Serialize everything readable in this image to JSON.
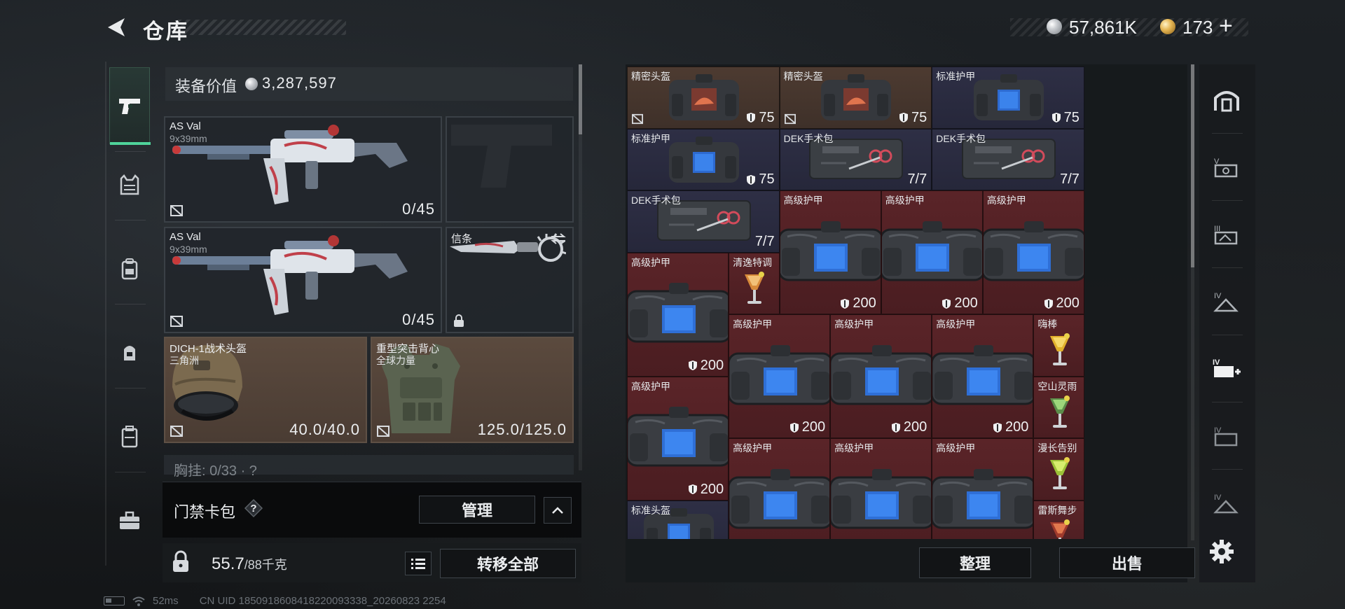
{
  "header": {
    "title": "仓库",
    "currencies": [
      {
        "icon": "silver-coin-icon",
        "value": "57,861K"
      },
      {
        "icon": "gold-coin-icon",
        "value": "173"
      }
    ],
    "add_currency": "+"
  },
  "equipment": {
    "value_label": "装备价值",
    "value": "3,287,597",
    "slots": {
      "gun1": {
        "name": "AS Val",
        "caliber": "9x39mm",
        "ammo": "0/45"
      },
      "gun2": {
        "name": "AS Val",
        "caliber": "9x39mm",
        "ammo": "0/45"
      },
      "knife": {
        "name": "信条"
      },
      "helmet": {
        "name": "DICH-1战术头盔",
        "sub": "三角洲",
        "durability": "40.0/40.0"
      },
      "armor": {
        "name": "重型突击背心",
        "sub": "全球力量",
        "durability": "125.0/125.0"
      }
    },
    "chest_rig": "胸挂: 0/33 · ?"
  },
  "keycard": {
    "label": "门禁卡包",
    "help": "?",
    "manage": "管理"
  },
  "footer_left": {
    "weight": "55.7",
    "weight_max": "/88千克",
    "transfer_all": "转移全部"
  },
  "storage": {
    "items": [
      {
        "id": "c1",
        "name": "精密头盔",
        "value": "75",
        "tint": "brown"
      },
      {
        "id": "c2",
        "name": "精密头盔",
        "value": "75",
        "tint": "brown"
      },
      {
        "id": "c3",
        "name": "标准护甲",
        "value": "75",
        "tint": "navy"
      },
      {
        "id": "c4",
        "name": "标准护甲",
        "value": "75",
        "tint": "navy"
      },
      {
        "id": "c5",
        "name": "DEK手术包",
        "value": "7/7",
        "tint": "navy"
      },
      {
        "id": "c6",
        "name": "DEK手术包",
        "value": "7/7",
        "tint": "navy"
      },
      {
        "id": "c7",
        "name": "DEK手术包",
        "value": "7/7",
        "tint": "navy"
      },
      {
        "id": "c8",
        "name": "高级护甲",
        "value": "200",
        "tint": "red"
      },
      {
        "id": "c9",
        "name": "高级护甲",
        "value": "200",
        "tint": "red"
      },
      {
        "id": "c10",
        "name": "高级护甲",
        "value": "200",
        "tint": "red"
      },
      {
        "id": "c11",
        "name": "高级护甲",
        "value": "200",
        "tint": "red"
      },
      {
        "id": "c12",
        "name": "清逸特调",
        "value": "",
        "tint": "red"
      },
      {
        "id": "c13",
        "name": "高级护甲",
        "value": "200",
        "tint": "red"
      },
      {
        "id": "c14",
        "name": "高级护甲",
        "value": "200",
        "tint": "red"
      },
      {
        "id": "c15",
        "name": "高级护甲",
        "value": "200",
        "tint": "red"
      },
      {
        "id": "c16",
        "name": "嗨棒",
        "value": "",
        "tint": "red"
      },
      {
        "id": "c17",
        "name": "高级护甲",
        "value": "200",
        "tint": "red"
      },
      {
        "id": "c18",
        "name": "空山灵雨",
        "value": "",
        "tint": "red"
      },
      {
        "id": "c19",
        "name": "高级护甲",
        "value": "",
        "tint": "red"
      },
      {
        "id": "c20",
        "name": "高级护甲",
        "value": "",
        "tint": "red"
      },
      {
        "id": "c21",
        "name": "高级护甲",
        "value": "",
        "tint": "red"
      },
      {
        "id": "c22",
        "name": "漫长告别",
        "value": "",
        "tint": "red"
      },
      {
        "id": "c23",
        "name": "标准头盔",
        "value": "",
        "tint": "navy"
      },
      {
        "id": "c24",
        "name": "雷斯舞步",
        "value": "",
        "tint": "red"
      }
    ],
    "sort": "整理",
    "sell": "出售"
  },
  "status_bar": {
    "ping": "52ms",
    "uid": "CN UID 1850918608418220093338_20260823 2254"
  },
  "colors": {
    "accent_green": "#4fd39a",
    "tint_brown": "#4d3b31",
    "tint_navy": "#2e2f45",
    "tint_red": "#5a2428"
  }
}
